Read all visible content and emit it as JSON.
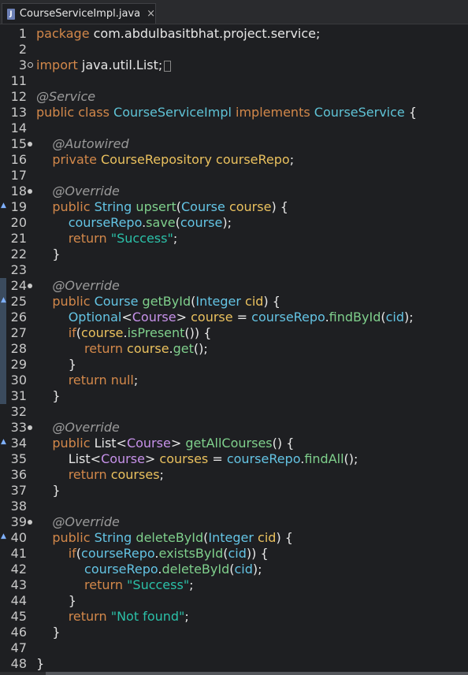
{
  "tab": {
    "icon": "java-file-icon",
    "title": "CourseServiceImpl.java",
    "close": "×"
  },
  "lines": [
    {
      "n": "1",
      "tokens": [
        [
          "kw",
          "package"
        ],
        [
          "plain",
          " com.abdulbasitbhat.project.service;"
        ]
      ]
    },
    {
      "n": "2",
      "tokens": []
    },
    {
      "n": "3",
      "marker": "exp",
      "tokens": [
        [
          "kw",
          "import"
        ],
        [
          "plain",
          " java.util.List;"
        ],
        [
          "fold",
          ""
        ]
      ]
    },
    {
      "n": "11",
      "tokens": []
    },
    {
      "n": "12",
      "tokens": [
        [
          "ann",
          "@Service"
        ]
      ]
    },
    {
      "n": "13",
      "tokens": [
        [
          "kw",
          "public class "
        ],
        [
          "cls",
          "CourseServiceImpl"
        ],
        [
          "kw",
          " implements "
        ],
        [
          "cls",
          "CourseService"
        ],
        [
          "plain",
          " {"
        ]
      ]
    },
    {
      "n": "14",
      "tokens": []
    },
    {
      "n": "15",
      "marker": "dot",
      "tokens": [
        [
          "ann",
          "    @Autowired"
        ]
      ]
    },
    {
      "n": "16",
      "tokens": [
        [
          "kw",
          "    private "
        ],
        [
          "var",
          "CourseRepository courseRepo"
        ],
        [
          "plain",
          ";"
        ]
      ]
    },
    {
      "n": "17",
      "tokens": []
    },
    {
      "n": "18",
      "marker": "dot",
      "tokens": [
        [
          "ann",
          "    @Override"
        ]
      ]
    },
    {
      "n": "19",
      "override": true,
      "tokens": [
        [
          "kw",
          "    public "
        ],
        [
          "type",
          "String "
        ],
        [
          "fn",
          "upsert"
        ],
        [
          "plain",
          "("
        ],
        [
          "type",
          "Course "
        ],
        [
          "var",
          "course"
        ],
        [
          "plain",
          ") {"
        ]
      ]
    },
    {
      "n": "20",
      "tokens": [
        [
          "type",
          "        courseRepo"
        ],
        [
          "plain",
          "."
        ],
        [
          "fn",
          "save"
        ],
        [
          "plain",
          "("
        ],
        [
          "type",
          "course"
        ],
        [
          "plain",
          ");"
        ]
      ]
    },
    {
      "n": "21",
      "tokens": [
        [
          "kw",
          "        return "
        ],
        [
          "str",
          "\"Success\""
        ],
        [
          "plain",
          ";"
        ]
      ]
    },
    {
      "n": "22",
      "tokens": [
        [
          "plain",
          "    }"
        ]
      ]
    },
    {
      "n": "23",
      "tokens": []
    },
    {
      "n": "24",
      "marker": "dot",
      "bar": true,
      "tokens": [
        [
          "ann",
          "    @Override"
        ]
      ]
    },
    {
      "n": "25",
      "override": true,
      "bar": true,
      "tokens": [
        [
          "kw",
          "    public "
        ],
        [
          "type",
          "Course "
        ],
        [
          "fn",
          "getById"
        ],
        [
          "plain",
          "("
        ],
        [
          "type",
          "Integer "
        ],
        [
          "var",
          "cid"
        ],
        [
          "plain",
          ") {"
        ]
      ]
    },
    {
      "n": "26",
      "bar": true,
      "tokens": [
        [
          "type",
          "        Optional"
        ],
        [
          "plain",
          "<"
        ],
        [
          "purple",
          "Course"
        ],
        [
          "plain",
          "> "
        ],
        [
          "var",
          "course"
        ],
        [
          "plain",
          " = "
        ],
        [
          "type",
          "courseRepo"
        ],
        [
          "plain",
          "."
        ],
        [
          "fn",
          "findById"
        ],
        [
          "plain",
          "("
        ],
        [
          "type",
          "cid"
        ],
        [
          "plain",
          ");"
        ]
      ]
    },
    {
      "n": "27",
      "bar": true,
      "tokens": [
        [
          "kw",
          "        if"
        ],
        [
          "plain",
          "("
        ],
        [
          "var",
          "course"
        ],
        [
          "plain",
          "."
        ],
        [
          "fn",
          "isPresent"
        ],
        [
          "plain",
          "()) {"
        ]
      ]
    },
    {
      "n": "28",
      "bar": true,
      "tokens": [
        [
          "kw",
          "            return "
        ],
        [
          "var",
          "course"
        ],
        [
          "plain",
          "."
        ],
        [
          "fn",
          "get"
        ],
        [
          "plain",
          "();"
        ]
      ]
    },
    {
      "n": "29",
      "bar": true,
      "tokens": [
        [
          "plain",
          "        }"
        ]
      ]
    },
    {
      "n": "30",
      "bar": true,
      "tokens": [
        [
          "kw",
          "        return null"
        ],
        [
          "plain",
          ";"
        ]
      ]
    },
    {
      "n": "31",
      "bar": true,
      "tokens": [
        [
          "plain",
          "    }"
        ]
      ]
    },
    {
      "n": "32",
      "tokens": []
    },
    {
      "n": "33",
      "marker": "dot",
      "tokens": [
        [
          "ann",
          "    @Override"
        ]
      ]
    },
    {
      "n": "34",
      "override": true,
      "tokens": [
        [
          "kw",
          "    public "
        ],
        [
          "plain",
          "List<"
        ],
        [
          "purple",
          "Course"
        ],
        [
          "plain",
          "> "
        ],
        [
          "fn",
          "getAllCourses"
        ],
        [
          "plain",
          "() {"
        ]
      ]
    },
    {
      "n": "35",
      "tokens": [
        [
          "plain",
          "        List<"
        ],
        [
          "purple",
          "Course"
        ],
        [
          "plain",
          "> "
        ],
        [
          "var",
          "courses"
        ],
        [
          "plain",
          " = "
        ],
        [
          "type",
          "courseRepo"
        ],
        [
          "plain",
          "."
        ],
        [
          "fn",
          "findAll"
        ],
        [
          "plain",
          "();"
        ]
      ]
    },
    {
      "n": "36",
      "tokens": [
        [
          "kw",
          "        return "
        ],
        [
          "var",
          "courses"
        ],
        [
          "plain",
          ";"
        ]
      ]
    },
    {
      "n": "37",
      "tokens": [
        [
          "plain",
          "    }"
        ]
      ]
    },
    {
      "n": "38",
      "tokens": []
    },
    {
      "n": "39",
      "marker": "dot",
      "tokens": [
        [
          "ann",
          "    @Override"
        ]
      ]
    },
    {
      "n": "40",
      "override": true,
      "tokens": [
        [
          "kw",
          "    public "
        ],
        [
          "type",
          "String "
        ],
        [
          "fn",
          "deleteById"
        ],
        [
          "plain",
          "("
        ],
        [
          "type",
          "Integer "
        ],
        [
          "var",
          "cid"
        ],
        [
          "plain",
          ") {"
        ]
      ]
    },
    {
      "n": "41",
      "tokens": [
        [
          "kw",
          "        if"
        ],
        [
          "plain",
          "("
        ],
        [
          "type",
          "courseRepo"
        ],
        [
          "plain",
          "."
        ],
        [
          "fn",
          "existsById"
        ],
        [
          "plain",
          "("
        ],
        [
          "type",
          "cid"
        ],
        [
          "plain",
          ")) {"
        ]
      ]
    },
    {
      "n": "42",
      "tokens": [
        [
          "type",
          "            courseRepo"
        ],
        [
          "plain",
          "."
        ],
        [
          "fn",
          "deleteById"
        ],
        [
          "plain",
          "("
        ],
        [
          "type",
          "cid"
        ],
        [
          "plain",
          ");"
        ]
      ]
    },
    {
      "n": "43",
      "tokens": [
        [
          "kw",
          "            return "
        ],
        [
          "str",
          "\"Success\""
        ],
        [
          "plain",
          ";"
        ]
      ]
    },
    {
      "n": "44",
      "tokens": [
        [
          "plain",
          "        }"
        ]
      ]
    },
    {
      "n": "45",
      "tokens": [
        [
          "kw",
          "        return "
        ],
        [
          "str",
          "\"Not found\""
        ],
        [
          "plain",
          ";"
        ]
      ]
    },
    {
      "n": "46",
      "tokens": [
        [
          "plain",
          "    }"
        ]
      ]
    },
    {
      "n": "47",
      "tokens": []
    },
    {
      "n": "48",
      "tokens": [
        [
          "plain",
          "}"
        ]
      ]
    }
  ]
}
